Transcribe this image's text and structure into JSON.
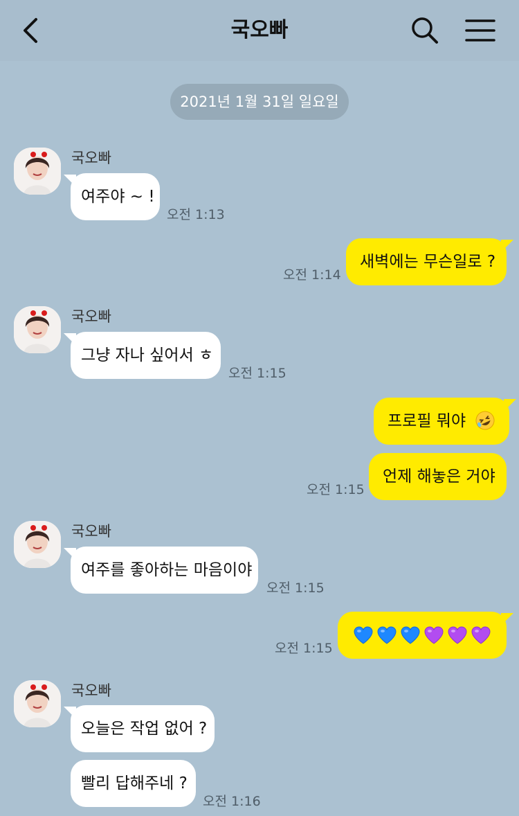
{
  "header": {
    "title": "국오빠",
    "back_icon": "chevron-left-icon",
    "search_icon": "search-icon",
    "menu_icon": "hamburger-menu-icon"
  },
  "date_divider": "2021년 1월 31일 일요일",
  "colors": {
    "background": "#abc1d1",
    "incoming_bubble": "#ffffff",
    "outgoing_bubble": "#ffeb00",
    "date_pill": "#96aab8"
  },
  "messages": [
    {
      "sender": "국오빠",
      "text": "여주야 ~ !",
      "time": "오전 1:13"
    },
    {
      "text": "새벽에는 무슨일로 ?",
      "time": "오전 1:14"
    },
    {
      "sender": "국오빠",
      "text": "그냥 자나 싶어서 ㅎ",
      "time": "오전 1:15"
    },
    {
      "text": "프로필 뭐야",
      "emoji": "rolling-on-floor-laughing-emoji"
    },
    {
      "text": "언제 해놓은 거야",
      "time": "오전 1:15"
    },
    {
      "sender": "국오빠",
      "text": "여주를 좋아하는 마음이야",
      "time": "오전 1:15"
    },
    {
      "hearts": [
        "blue",
        "blue",
        "blue",
        "purple",
        "purple",
        "purple"
      ],
      "time": "오전 1:15"
    },
    {
      "sender": "국오빠",
      "text": "오늘은 작업 없어 ?"
    },
    {
      "text": "빨리 답해주네 ?",
      "time": "오전 1:16"
    }
  ]
}
